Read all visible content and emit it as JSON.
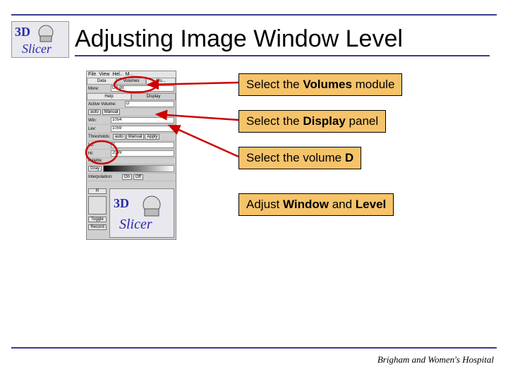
{
  "title": "Adjusting Image Window Level",
  "logo": {
    "line1": "3D",
    "line2": "Slicer"
  },
  "app": {
    "menubar": [
      "File",
      "View",
      "Hel..",
      "M..."
    ],
    "tabrow1": {
      "left": "Data",
      "mid": "Volumes",
      "right": "Mo..."
    },
    "tabrow1b": "D Edit",
    "more_label": "More:",
    "tabrow2": {
      "left": "Help",
      "right": "Display"
    },
    "active_vol_label": "Active Volume:",
    "active_vol_value": "D",
    "auto_label": "auto",
    "manual_label": "Manual",
    "win_label": "Win:",
    "win_value": "1054",
    "lev_label": "Lev:",
    "lev_value": "1059",
    "thresh_label": "Thresholds:",
    "thresh_auto": "auto",
    "thresh_manual": "Manual",
    "thresh_apply": "Apply",
    "lo_label": "Lo:",
    "lo_value": "0",
    "hi_label": "Hi:",
    "hi_value": "2049",
    "palette_label": "Palette:",
    "gray_label": "Gray",
    "interp_label": "Interpolation:",
    "on": "On",
    "off": "Off",
    "btn_r": "R",
    "btn_toggle": "Toggle",
    "btn_record": "Record"
  },
  "callouts": {
    "c1_pre": "Select the ",
    "c1_bold": "Volumes",
    "c1_post": " module",
    "c2_pre": "Select the ",
    "c2_bold": "Display",
    "c2_post": " panel",
    "c3_pre": "Select the volume ",
    "c3_bold": "D",
    "c4_pre": "Adjust ",
    "c4_b1": "Window",
    "c4_mid": " and ",
    "c4_b2": "Level"
  },
  "footer": "Brigham and Women's Hospital"
}
